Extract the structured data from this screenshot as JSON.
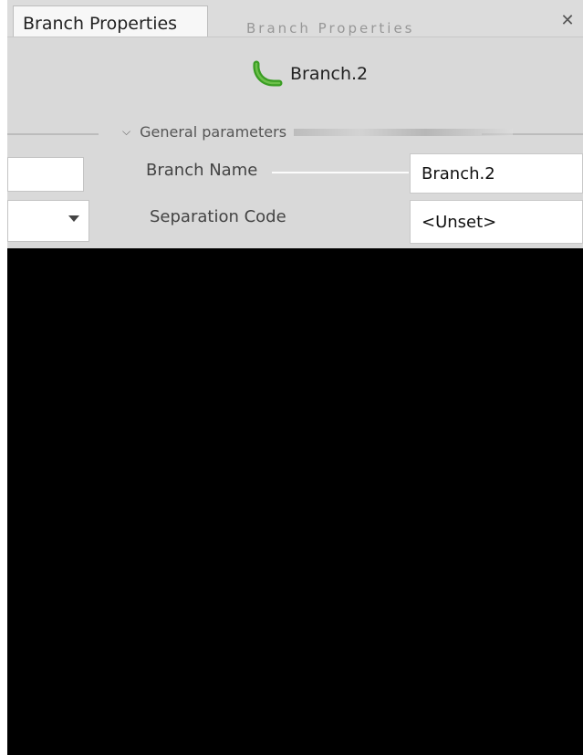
{
  "tabs": {
    "active_label": "Branch Properties",
    "ghost_label": "Branch Properties"
  },
  "header": {
    "object_name": "Branch.2",
    "object_icon": "branch-icon"
  },
  "section": {
    "title": "General parameters"
  },
  "properties": [
    {
      "label": "Branch Name",
      "value": "Branch.2"
    },
    {
      "label": "Separation Code",
      "value": "<Unset>"
    }
  ],
  "colors": {
    "panel_bg": "#d9d9d9",
    "content_bg": "#000000",
    "icon_green": "#3a9d23"
  }
}
